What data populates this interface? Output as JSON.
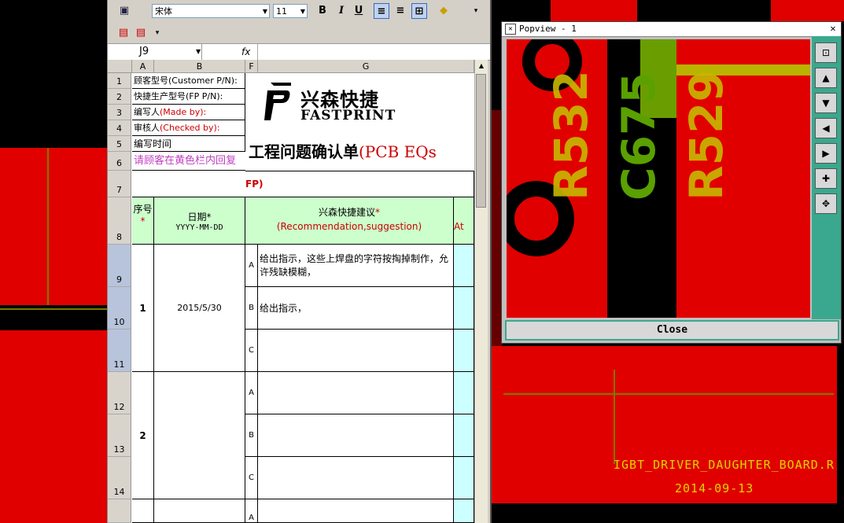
{
  "toolbar": {
    "font_name": "宋体",
    "font_size": "11",
    "bold": "B",
    "italic": "I",
    "underline": "U"
  },
  "formula_bar": {
    "cell_ref": "J9",
    "fx": "fx"
  },
  "columns": [
    "A",
    "B",
    "F",
    "G"
  ],
  "rows": [
    "1",
    "2",
    "3",
    "4",
    "5",
    "6",
    "7",
    "8",
    "9",
    "10",
    "11",
    "12",
    "13",
    "14"
  ],
  "header": {
    "r1": "顾客型号(Customer P/N):",
    "r2": "快捷生产型号(FP P/N):",
    "r3_a": "编写人",
    "r3_b": "(Made by):",
    "r4_a": "审核人",
    "r4_b": "(Checked by):",
    "r5": "编写时间",
    "r6": "请顾客在黄色栏内回复",
    "r7": "FP)",
    "logo_cn": "兴森快捷",
    "logo_en": "FASTPRINT",
    "title_cn": "工程问题确认单",
    "title_en": "(PCB EQs"
  },
  "table_head": {
    "seq": "序号",
    "seq_star": "*",
    "date": "日期*",
    "date_fmt": "YYYY-MM-DD",
    "rec_cn": "兴森快捷建议",
    "rec_star": "*",
    "rec_en": "(Recommendation,suggestion)",
    "att": "At"
  },
  "entries": [
    {
      "no": "1",
      "date": "2015/5/30",
      "items": [
        {
          "letter": "A",
          "text1": "给出指示，这些上焊盘的字符按掏掉制作，允",
          "text2": "许残缺模糊，"
        },
        {
          "letter": "B",
          "text1": "给出指示，",
          "text2": ""
        },
        {
          "letter": "C",
          "text1": "",
          "text2": ""
        }
      ]
    },
    {
      "no": "2",
      "date": "",
      "items": [
        {
          "letter": "A",
          "text1": "",
          "text2": ""
        },
        {
          "letter": "B",
          "text1": "",
          "text2": ""
        },
        {
          "letter": "C",
          "text1": "",
          "text2": ""
        }
      ]
    },
    {
      "no": "",
      "date": "",
      "items": [
        {
          "letter": "A",
          "text1": "",
          "text2": ""
        }
      ]
    }
  ],
  "popview": {
    "title": "Popview - 1",
    "labels": [
      "R532",
      "C675",
      "R529"
    ],
    "close": "Close"
  },
  "pcb": {
    "board_name": "IGBT_DRIVER_DAUGHTER_BOARD.R",
    "board_date": "2014-09-13"
  },
  "colors": {
    "pcb_red": "#e00000",
    "silk_yellow": "#d8d000",
    "pop_green": "#3aa88e",
    "cell_green": "#ccffcc",
    "cell_cyan": "#ccffff"
  }
}
